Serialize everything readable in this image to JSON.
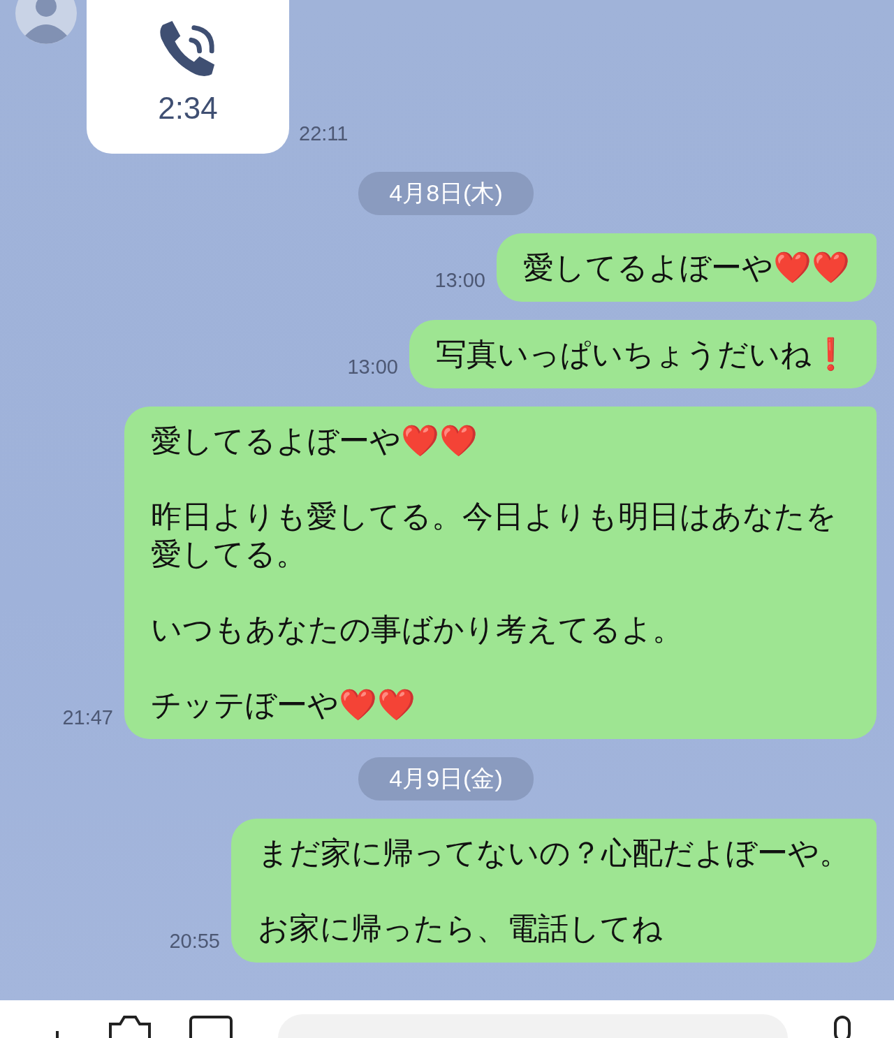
{
  "messages": [
    {
      "kind": "call",
      "duration": "2:34",
      "time": "22:11"
    },
    {
      "kind": "date",
      "text": "4月8日(木)"
    },
    {
      "kind": "text",
      "paragraphs": [
        "愛してるよぼーや❤️❤️"
      ],
      "time": "13:00"
    },
    {
      "kind": "text",
      "paragraphs": [
        "写真いっぱいちょうだいね❗"
      ],
      "time": "13:00"
    },
    {
      "kind": "text",
      "paragraphs": [
        "愛してるよぼーや❤️❤️",
        "昨日よりも愛してる。今日よりも明日はあなたを愛してる。",
        "いつもあなたの事ばかり考えてるよ。",
        "チッテぼーや❤️❤️"
      ],
      "time": "21:47"
    },
    {
      "kind": "date",
      "text": "4月9日(金)"
    },
    {
      "kind": "text",
      "paragraphs": [
        "まだ家に帰ってないの？心配だよぼーや。",
        "お家に帰ったら、電話してね"
      ],
      "time": "20:55"
    }
  ]
}
